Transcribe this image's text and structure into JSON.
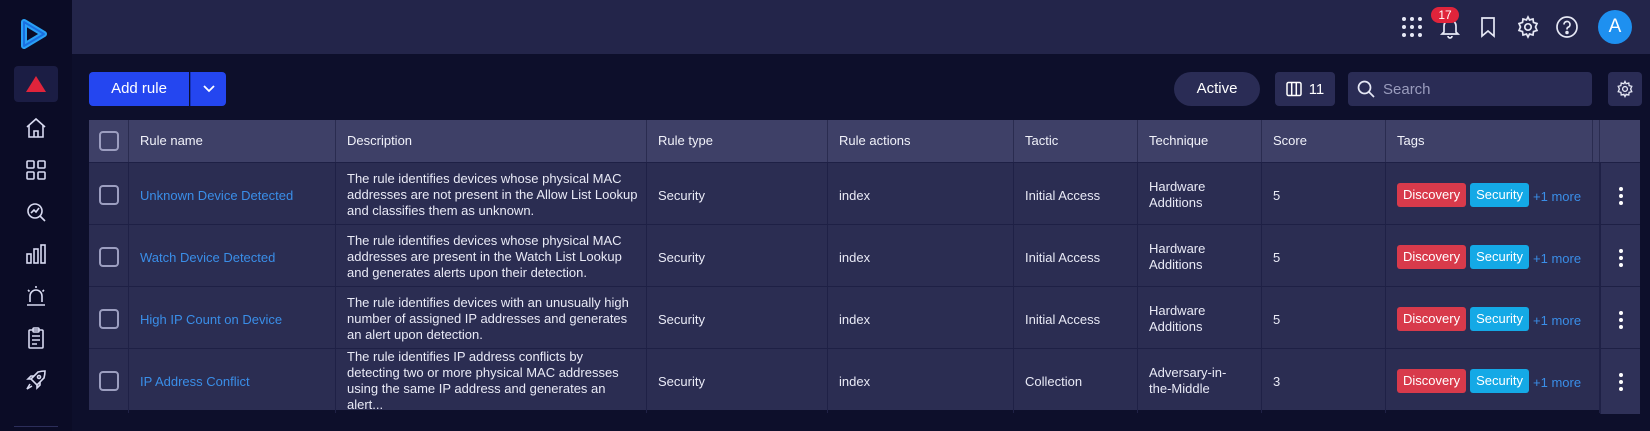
{
  "colors": {
    "accent": "#2446f0",
    "tag_discovery": "#d83a4b",
    "tag_security": "#14a9e6",
    "link": "#3a8ee8",
    "badge": "#e0243b"
  },
  "sidebar": {
    "items": [
      {
        "icon": "alert-triangle-icon"
      },
      {
        "icon": "home-icon"
      },
      {
        "icon": "dashboard-grid-icon"
      },
      {
        "icon": "analytics-search-icon"
      },
      {
        "icon": "bar-chart-icon"
      },
      {
        "icon": "siren-alarm-icon"
      },
      {
        "icon": "clipboard-list-icon"
      },
      {
        "icon": "rocket-icon"
      }
    ]
  },
  "topbar": {
    "notification_count": "17",
    "avatar_initial": "A"
  },
  "toolbar": {
    "add_rule_label": "Add rule",
    "status_filter": "Active",
    "columns_count": "11",
    "search_placeholder": "Search"
  },
  "table": {
    "columns": [
      "Rule name",
      "Description",
      "Rule type",
      "Rule actions",
      "Tactic",
      "Technique",
      "Score",
      "Tags"
    ],
    "rows": [
      {
        "name": "Unknown Device Detected",
        "desc": [
          "The rule identifies devices whose physical MAC",
          "addresses are not present in the Allow List Lookup",
          "and classifies them as unknown."
        ],
        "type": "Security",
        "actions": "index",
        "tactic": "Initial Access",
        "technique": [
          "Hardware",
          "Additions"
        ],
        "score": "5",
        "tags": [
          "Discovery",
          "Security"
        ],
        "more": "+1 more"
      },
      {
        "name": "Watch Device Detected",
        "desc": [
          "The rule identifies devices whose physical MAC",
          "addresses are present in the Watch List Lookup",
          "and generates alerts upon their detection."
        ],
        "type": "Security",
        "actions": "index",
        "tactic": "Initial Access",
        "technique": [
          "Hardware",
          "Additions"
        ],
        "score": "5",
        "tags": [
          "Discovery",
          "Security"
        ],
        "more": "+1 more"
      },
      {
        "name": "High IP Count on Device",
        "desc": [
          "The rule identifies devices with an unusually high",
          "number of assigned IP addresses and generates",
          "an alert upon detection."
        ],
        "type": "Security",
        "actions": "index",
        "tactic": "Initial Access",
        "technique": [
          "Hardware",
          "Additions"
        ],
        "score": "5",
        "tags": [
          "Discovery",
          "Security"
        ],
        "more": "+1 more"
      },
      {
        "name": "IP Address Conflict",
        "desc": [
          "The rule identifies IP address conflicts by",
          "detecting two or more physical MAC addresses",
          "using the same IP address and generates an alert..."
        ],
        "type": "Security",
        "actions": "index",
        "tactic": "Collection",
        "technique": [
          "Adversary-in-",
          "the-Middle"
        ],
        "score": "3",
        "tags": [
          "Discovery",
          "Security"
        ],
        "more": "+1 more"
      }
    ]
  }
}
